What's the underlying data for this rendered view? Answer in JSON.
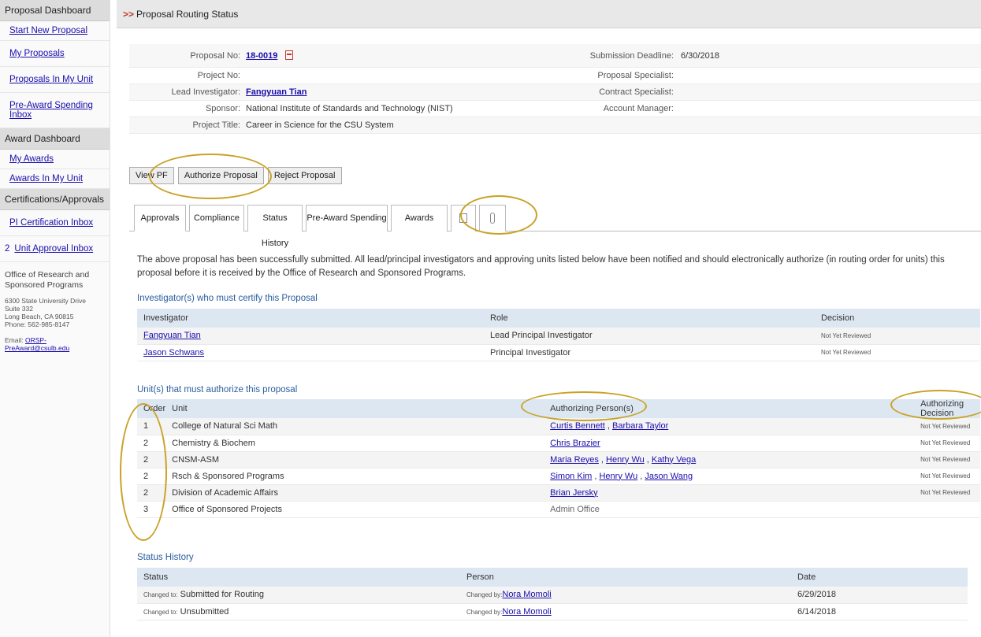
{
  "sidebar": {
    "proposal_dashboard": "Proposal Dashboard",
    "proposal_items": [
      "Start New Proposal",
      "My Proposals",
      "Proposals In My Unit",
      "Pre-Award Spending Inbox"
    ],
    "award_dashboard": "Award Dashboard",
    "award_items": [
      "My Awards",
      "Awards In My Unit"
    ],
    "cert_heading": "Certifications/Approvals",
    "pi_cert_inbox": "PI Certification Inbox",
    "unit_inbox_count": "2",
    "unit_inbox": "Unit Approval Inbox",
    "office_line1": "Office of Research and",
    "office_line2": "Sponsored Programs",
    "address_line1": "6300 State University Drive",
    "address_line2": "Suite 332",
    "address_line3": "Long Beach, CA 90815",
    "address_line4": "Phone: 562-985-8147",
    "email_label": "Email:",
    "email": "ORSP-PreAward@csulb.edu"
  },
  "page_title": "Proposal Routing Status",
  "page_title_prefix": ">>",
  "info": {
    "proposal_no_label": "Proposal No:",
    "proposal_no": "18-0019",
    "project_no_label": "Project No:",
    "lead_inv_label": "Lead Investigator:",
    "lead_inv": "Fangyuan Tian",
    "sponsor_label": "Sponsor:",
    "sponsor": "National Institute of Standards and Technology (NIST)",
    "title_label": "Project Title:",
    "title": "Career in Science for the CSU System",
    "deadline_label": "Submission Deadline:",
    "deadline": "6/30/2018",
    "prop_spec_label": "Proposal Specialist:",
    "contract_spec_label": "Contract Specialist:",
    "acct_mgr_label": "Account Manager:"
  },
  "actions": {
    "view_pf": "View PF",
    "authorize": "Authorize Proposal",
    "reject": "Reject Proposal"
  },
  "tabs": {
    "approvals": "Approvals",
    "compliance": "Compliance",
    "status_history": "Status History",
    "pre_award": "Pre-Award Spending",
    "awards": "Awards"
  },
  "notice": "The above proposal has been successfully submitted. All lead/principal investigators and approving units listed below have been notified and should electronically authorize (in routing order for units) this proposal before it is received by the Office of Research and Sponsored Programs.",
  "investigators": {
    "title": "Investigator(s) who must certify this Proposal",
    "headers": [
      "Investigator",
      "Role",
      "Decision"
    ],
    "rows": [
      {
        "name": "Fangyuan Tian",
        "role": "Lead Principal Investigator",
        "decision": "Not Yet Reviewed"
      },
      {
        "name": "Jason Schwans",
        "role": "Principal Investigator",
        "decision": "Not Yet Reviewed"
      }
    ]
  },
  "units": {
    "title": "Unit(s) that must authorize this proposal",
    "headers": [
      "Order",
      "Unit",
      "Authorizing Person(s)",
      "Authorizing Decision"
    ],
    "rows": [
      {
        "order": "1",
        "unit": "College of Natural Sci Math",
        "persons": [
          "Curtis Bennett",
          "Barbara Taylor"
        ],
        "decision": "Not Yet Reviewed"
      },
      {
        "order": "2",
        "unit": "Chemistry & Biochem",
        "persons": [
          "Chris Brazier"
        ],
        "decision": "Not Yet Reviewed"
      },
      {
        "order": "2",
        "unit": "CNSM-ASM",
        "persons": [
          "Maria Reyes",
          "Henry Wu",
          "Kathy Vega"
        ],
        "decision": "Not Yet Reviewed"
      },
      {
        "order": "2",
        "unit": "Rsch & Sponsored Programs",
        "persons": [
          "Simon Kim",
          "Henry Wu",
          "Jason Wang"
        ],
        "decision": "Not Yet Reviewed"
      },
      {
        "order": "2",
        "unit": "Division of Academic Affairs",
        "persons": [
          "Brian Jersky"
        ],
        "decision": "Not Yet Reviewed"
      },
      {
        "order": "3",
        "unit": "Office of Sponsored Projects",
        "persons_text": "Admin Office",
        "decision": ""
      }
    ]
  },
  "history": {
    "title": "Status History",
    "headers": [
      "Status",
      "Person",
      "Date"
    ],
    "changed_to": "Changed to:",
    "changed_by": "Changed by:",
    "rows": [
      {
        "status": "Submitted for Routing",
        "person": "Nora Momoli",
        "date": "6/29/2018"
      },
      {
        "status": "Unsubmitted",
        "person": "Nora Momoli",
        "date": "6/14/2018"
      }
    ]
  },
  "colors": {
    "annotation": "#c9a227",
    "link": "#1a0dab",
    "section_title": "#2a5d9f",
    "header_bg": "#dde7f2"
  }
}
